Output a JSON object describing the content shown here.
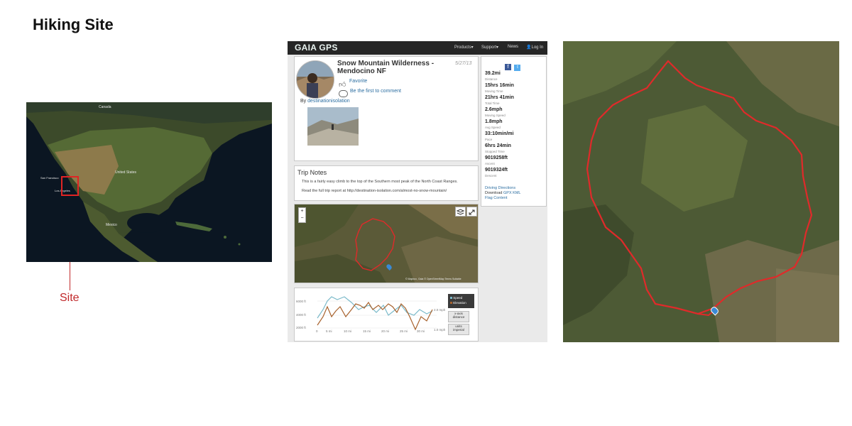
{
  "slide": {
    "title": "Hiking Site"
  },
  "overview_map": {
    "labels": {
      "canada": "Canada",
      "united_states": "United States",
      "san_francisco": "San Francisco",
      "los_angeles": "Los Angeles",
      "mexico": "Mexico",
      "site": "Site"
    },
    "highlight_color": "#e02424"
  },
  "gaia": {
    "logo": "GAIA GPS",
    "nav": {
      "products": "Products▾",
      "support": "Support▾",
      "news": "News",
      "login": "Log In"
    },
    "trip": {
      "title": "Snow Mountain Wilderness - Mendocino NF",
      "date": "5/27/13",
      "favorite": "Favorite",
      "comment": "Be the first to comment",
      "by": "By",
      "author": "destinationisolation"
    },
    "stats": [
      {
        "value": "39.2mi",
        "label": "Distance"
      },
      {
        "value": "15hrs 16min",
        "label": "Moving Time"
      },
      {
        "value": "21hrs 41min",
        "label": "Total Time"
      },
      {
        "value": "2.6mph",
        "label": "Moving Speed"
      },
      {
        "value": "1.8mph",
        "label": "Avg Speed"
      },
      {
        "value": "33:10min/mi",
        "label": "Pace"
      },
      {
        "value": "6hrs 24min",
        "label": "Stopped Time"
      },
      {
        "value": "9019258ft",
        "label": "Ascent"
      },
      {
        "value": "9019324ft",
        "label": "Descent"
      }
    ],
    "links": {
      "directions": "Driving Directions",
      "download": "Download",
      "gpx": "GPX",
      "kml": "KML",
      "flag": "Flag Content"
    },
    "notes": {
      "heading": "Trip Notes",
      "p1": "This is a fairly easy climb to the top of the Southern most peak of the North Coast Ranges.",
      "p2": "Read the full trip report at http://destination-isolation.com/almost-no-snow-mountain/"
    },
    "map": {
      "zoom_in": "+",
      "zoom_out": "−",
      "attribution": "© Mapbox, Gaia © OpenStreetMap Terms Suitable"
    },
    "chart": {
      "y_ticks": [
        "6000 ft",
        "4000 ft",
        "2000 ft"
      ],
      "x_ticks": [
        "0",
        "5 mi",
        "10 mi",
        "15 mi",
        "20 mi",
        "25 mi",
        "30 mi"
      ],
      "speed_ticks": [
        "2.0 mph",
        "1.0 mph"
      ],
      "legend": {
        "speed": "Speed",
        "elevation": "Elevation"
      },
      "xaxis_label": "x-axis",
      "xaxis_value": "distance",
      "units_label": "units",
      "units_value": "imperial"
    }
  },
  "colors": {
    "track": "#e02a2a",
    "nav_bg": "#262626",
    "link": "#2c6ea1",
    "elevation": "#a8622d",
    "speed": "#79b9c9"
  }
}
